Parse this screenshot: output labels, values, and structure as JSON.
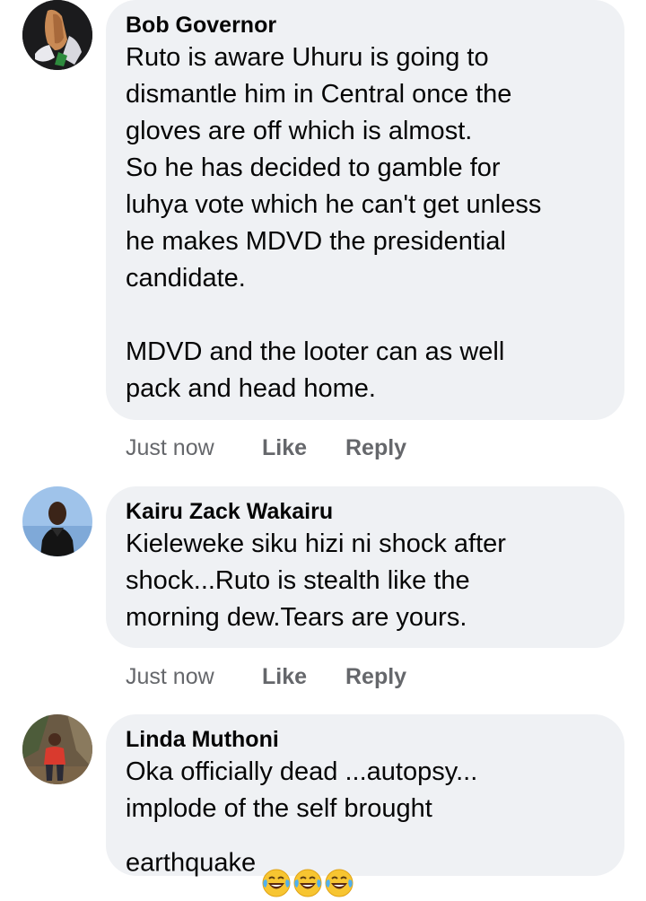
{
  "comments": [
    {
      "author": "Bob Governor",
      "text": "Ruto is aware Uhuru is going to\ndismantle him in Central once the\ngloves are off which is almost.\nSo he has decided to gamble for\nluhya vote which he can't get unless\nhe makes MDVD the presidential\ncandidate.\n\nMDVD and the looter can as well\npack and head home.",
      "time": "Just now",
      "like": "Like",
      "reply": "Reply",
      "avatar_icon": "praying-hands-avatar"
    },
    {
      "author": "Kairu Zack Wakairu",
      "text": "Kieleweke siku hizi ni shock after\nshock...Ruto is stealth like the\nmorning dew.Tears are yours.",
      "time": "Just now",
      "like": "Like",
      "reply": "Reply",
      "avatar_icon": "man-portrait-avatar"
    },
    {
      "author": "Linda Muthoni",
      "text": "Oka officially dead ...autopsy...\nimplode of the self brought\nearthquake",
      "emoji": [
        "laughing-crying-emoji",
        "laughing-crying-emoji",
        "laughing-crying-emoji"
      ],
      "avatar_icon": "woman-outdoor-avatar"
    }
  ],
  "colors": {
    "bubble": "#eff1f4",
    "meta_text": "#65676b",
    "text": "#050505"
  }
}
